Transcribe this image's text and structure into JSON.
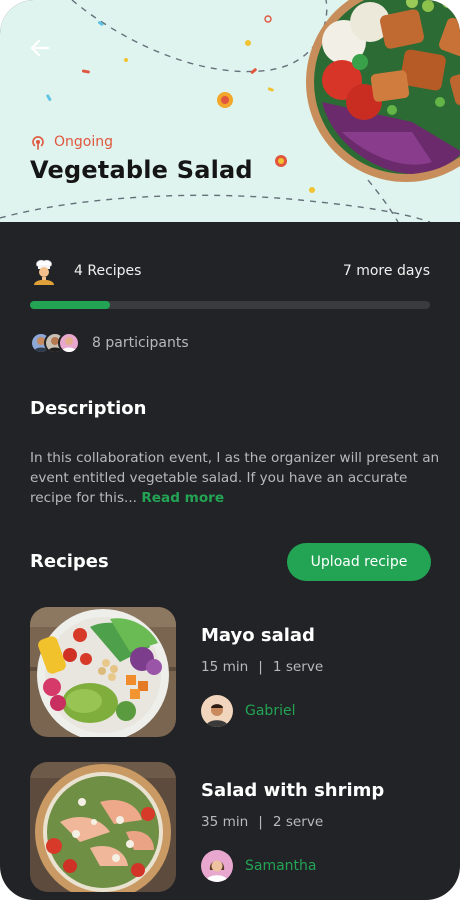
{
  "header": {
    "back_icon": "arrow-left-icon",
    "status_label": "Ongoing",
    "status_icon": "broadcast-icon",
    "status_color": "#e0573e",
    "title": "Vegetable Salad",
    "background_color": "#dff4ee"
  },
  "stats": {
    "recipes_label": "4 Recipes",
    "days_label": "7 more days",
    "progress_fraction": 0.2,
    "progress_color": "#22a454",
    "participants_label": "8 participants"
  },
  "description": {
    "title": "Description",
    "text": "In this collaboration event, I as the organizer will present an event entitled vegetable salad. If you have an accurate recipe for this... ",
    "read_more": "Read more"
  },
  "recipes": {
    "title": "Recipes",
    "upload_label": "Upload recipe",
    "items": [
      {
        "name": "Mayo salad",
        "time": "15 min",
        "serves": "1 serve",
        "author": "Gabriel"
      },
      {
        "name": "Salad with shrimp",
        "time": "35 min",
        "serves": "2 serve",
        "author": "Samantha"
      }
    ]
  },
  "theme": {
    "background": "#222326",
    "accent": "#22a454"
  }
}
